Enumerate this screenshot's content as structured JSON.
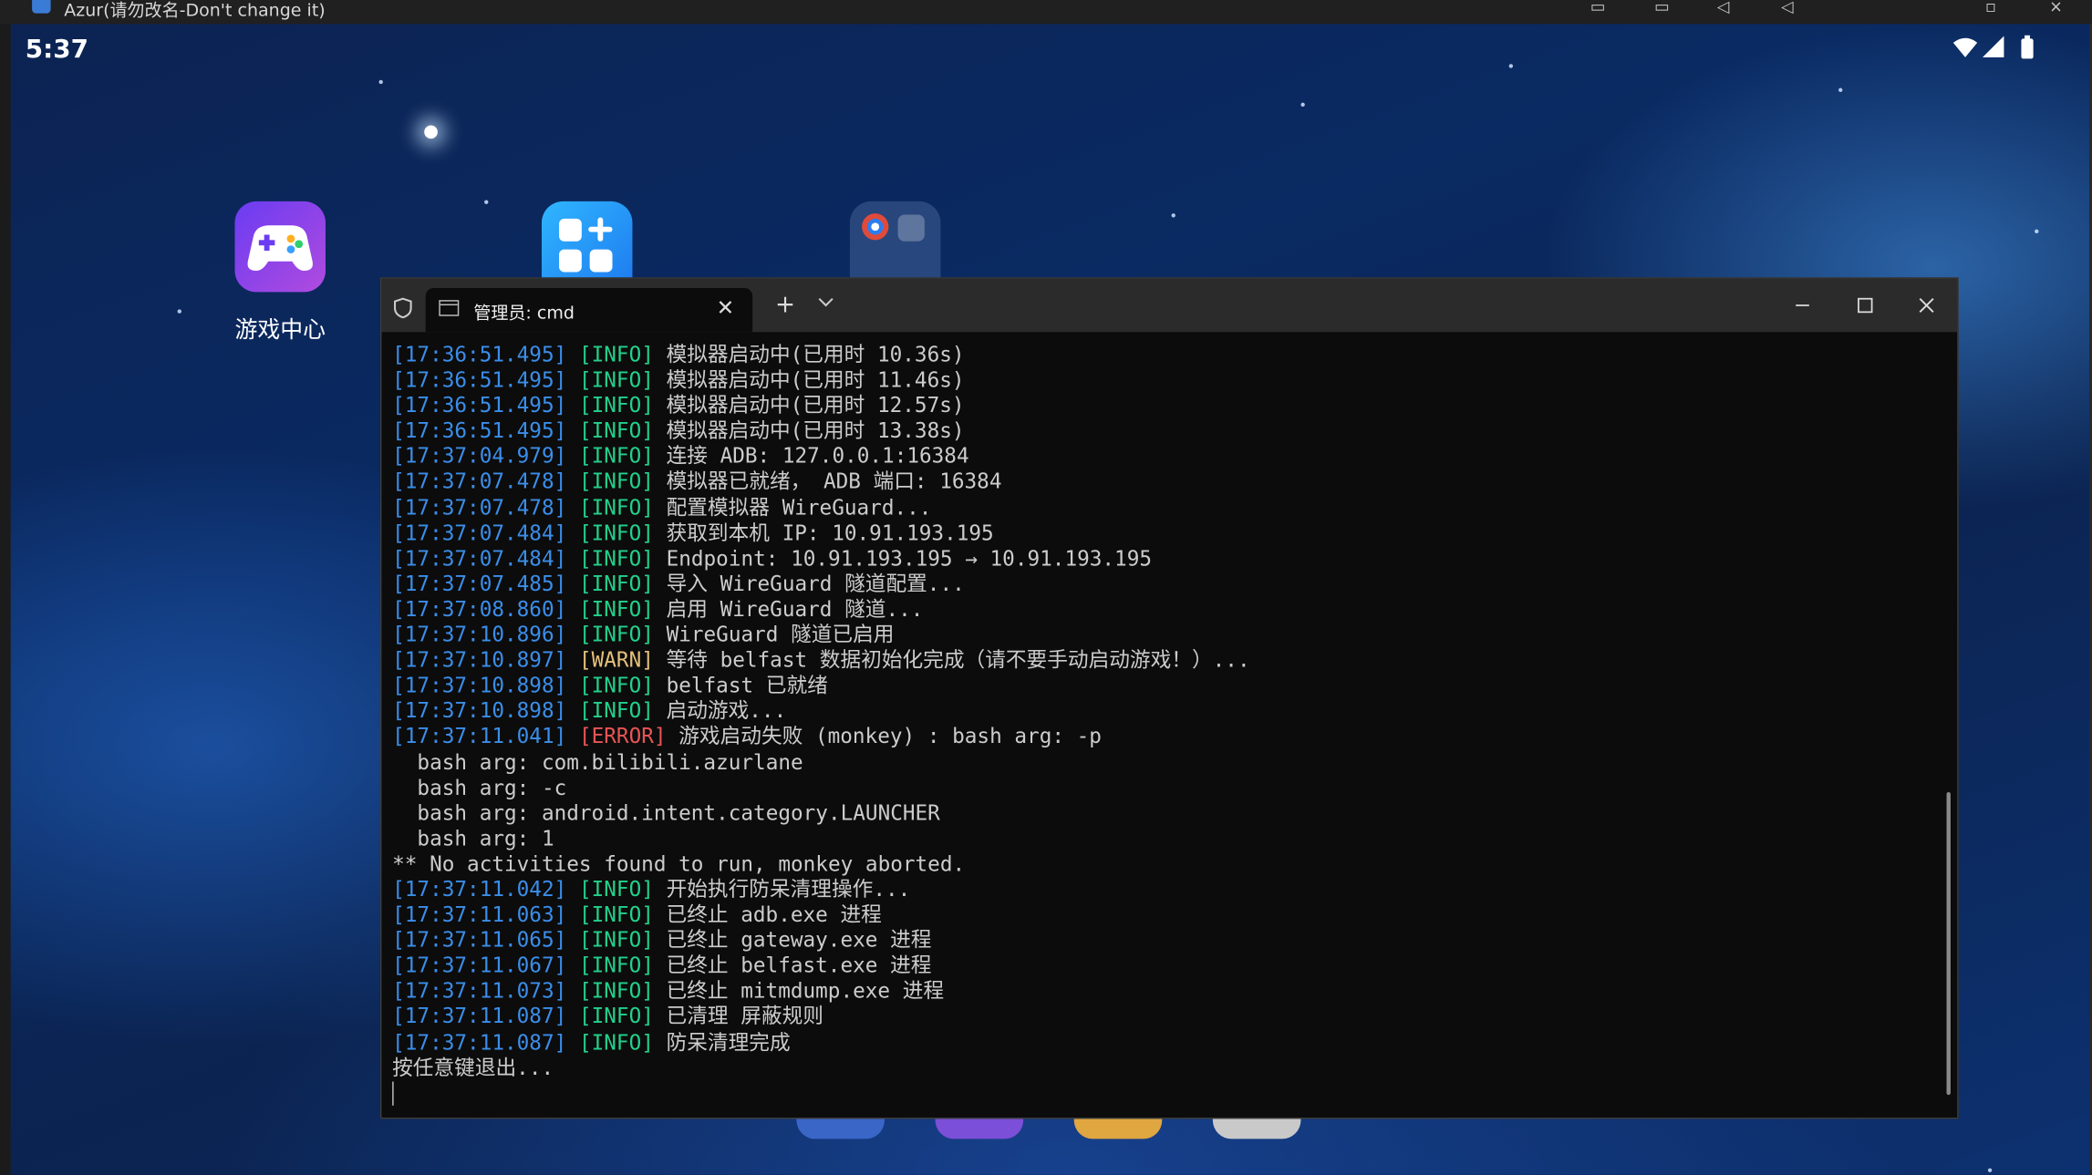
{
  "host_window": {
    "title": "Azur(请勿改名-Don't change it)"
  },
  "status_bar": {
    "time": "5:37"
  },
  "desktop": {
    "icons": [
      {
        "label": "游戏中心",
        "icon": "gamepad-icon"
      },
      {
        "label": "",
        "icon": "app-store-icon"
      },
      {
        "label": "",
        "icon": "folder-icon"
      }
    ]
  },
  "terminal": {
    "tab_title": "管理员: cmd",
    "lines": [
      {
        "ts": "[17:36:51.495]",
        "level": "INFO",
        "msg": "模拟器启动中(已用时 10.36s)"
      },
      {
        "ts": "[17:36:51.495]",
        "level": "INFO",
        "msg": "模拟器启动中(已用时 11.46s)"
      },
      {
        "ts": "[17:36:51.495]",
        "level": "INFO",
        "msg": "模拟器启动中(已用时 12.57s)"
      },
      {
        "ts": "[17:36:51.495]",
        "level": "INFO",
        "msg": "模拟器启动中(已用时 13.38s)"
      },
      {
        "ts": "[17:37:04.979]",
        "level": "INFO",
        "msg": "连接 ADB: 127.0.0.1:16384"
      },
      {
        "ts": "[17:37:07.478]",
        "level": "INFO",
        "msg": "模拟器已就绪， ADB 端口: 16384"
      },
      {
        "ts": "[17:37:07.478]",
        "level": "INFO",
        "msg": "配置模拟器 WireGuard..."
      },
      {
        "ts": "[17:37:07.484]",
        "level": "INFO",
        "msg": "获取到本机 IP: 10.91.193.195"
      },
      {
        "ts": "[17:37:07.484]",
        "level": "INFO",
        "msg": "Endpoint: 10.91.193.195 → 10.91.193.195"
      },
      {
        "ts": "[17:37:07.485]",
        "level": "INFO",
        "msg": "导入 WireGuard 隧道配置..."
      },
      {
        "ts": "[17:37:08.860]",
        "level": "INFO",
        "msg": "启用 WireGuard 隧道..."
      },
      {
        "ts": "[17:37:10.896]",
        "level": "INFO",
        "msg": "WireGuard 隧道已启用"
      },
      {
        "ts": "[17:37:10.897]",
        "level": "WARN",
        "msg": "等待 belfast 数据初始化完成（请不要手动启动游戏！）..."
      },
      {
        "ts": "[17:37:10.898]",
        "level": "INFO",
        "msg": "belfast 已就绪"
      },
      {
        "ts": "[17:37:10.898]",
        "level": "INFO",
        "msg": "启动游戏..."
      },
      {
        "ts": "[17:37:11.041]",
        "level": "ERROR",
        "msg": "游戏启动失败 (monkey) : bash arg: -p"
      },
      {
        "ts": "",
        "level": "",
        "msg": "  bash arg: com.bilibili.azurlane"
      },
      {
        "ts": "",
        "level": "",
        "msg": "  bash arg: -c"
      },
      {
        "ts": "",
        "level": "",
        "msg": "  bash arg: android.intent.category.LAUNCHER"
      },
      {
        "ts": "",
        "level": "",
        "msg": "  bash arg: 1"
      },
      {
        "ts": "",
        "level": "",
        "msg": "** No activities found to run, monkey aborted."
      },
      {
        "ts": "[17:37:11.042]",
        "level": "INFO",
        "msg": "开始执行防呆清理操作..."
      },
      {
        "ts": "[17:37:11.063]",
        "level": "INFO",
        "msg": "已终止 adb.exe 进程"
      },
      {
        "ts": "[17:37:11.065]",
        "level": "INFO",
        "msg": "已终止 gateway.exe 进程"
      },
      {
        "ts": "[17:37:11.067]",
        "level": "INFO",
        "msg": "已终止 belfast.exe 进程"
      },
      {
        "ts": "[17:37:11.073]",
        "level": "INFO",
        "msg": "已终止 mitmdump.exe 进程"
      },
      {
        "ts": "[17:37:11.087]",
        "level": "INFO",
        "msg": "已清理 屏蔽规则"
      },
      {
        "ts": "[17:37:11.087]",
        "level": "INFO",
        "msg": "防呆清理完成"
      },
      {
        "ts": "",
        "level": "",
        "msg": "按任意键退出..."
      }
    ]
  },
  "colors": {
    "timestamp": "#3b8eea",
    "info": "#23d18b",
    "warn": "#e5c07b",
    "error": "#e85555",
    "text": "#cccccc",
    "terminal_bg": "#0c0c0c"
  }
}
